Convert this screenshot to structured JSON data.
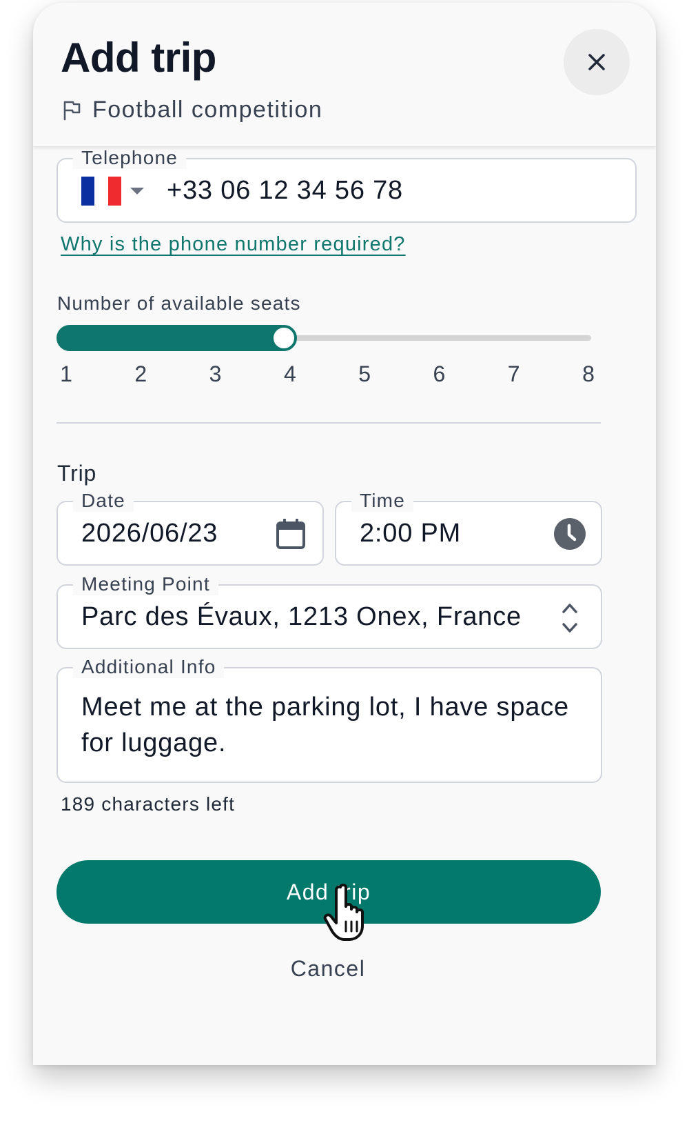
{
  "header": {
    "title": "Add trip",
    "subtitle": "Football competition"
  },
  "telephone": {
    "label": "Telephone",
    "value": "+33 06 12 34 56 78",
    "country_flag": "france-flag"
  },
  "help_link": "Why is the phone number required?",
  "seats": {
    "label": "Number of available seats",
    "ticks": [
      "1",
      "2",
      "3",
      "4",
      "5",
      "6",
      "7",
      "8"
    ],
    "selected": 4,
    "min": 1,
    "max": 8
  },
  "trip": {
    "section_title": "Trip",
    "date": {
      "label": "Date",
      "value": "2026/06/23"
    },
    "time": {
      "label": "Time",
      "value": "2:00 PM"
    },
    "meeting_point": {
      "label": "Meeting Point",
      "value": "Parc des Évaux, 1213 Onex, France"
    },
    "additional_info": {
      "label": "Additional Info",
      "value": "Meet me at the parking lot, I have space for luggage."
    },
    "chars_left": "189 characters left"
  },
  "actions": {
    "primary": "Add trip",
    "secondary": "Cancel"
  },
  "colors": {
    "accent": "#02796b",
    "accent_dark": "#0f766e",
    "background": "#f9f9f9"
  }
}
